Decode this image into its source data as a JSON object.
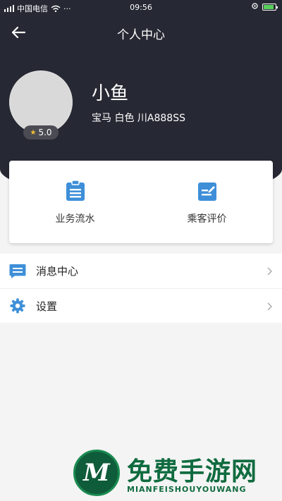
{
  "status_bar": {
    "carrier": "中国电信",
    "time": "09:56"
  },
  "header": {
    "title": "个人中心"
  },
  "profile": {
    "name": "小鱼",
    "car": "宝马 白色 川A888SS",
    "rating": "5.0"
  },
  "actions": [
    {
      "label": "业务流水",
      "icon": "clipboard-icon"
    },
    {
      "label": "乘客评价",
      "icon": "edit-icon"
    }
  ],
  "menu": [
    {
      "label": "消息中心",
      "icon": "message-icon"
    },
    {
      "label": "设置",
      "icon": "gear-icon"
    }
  ],
  "watermark": {
    "badge": "M",
    "title": "免费手游网",
    "subtitle": "MIANFEISHOUYOUWANG"
  },
  "colors": {
    "header_bg": "#262833",
    "accent": "#3e8fd8"
  }
}
